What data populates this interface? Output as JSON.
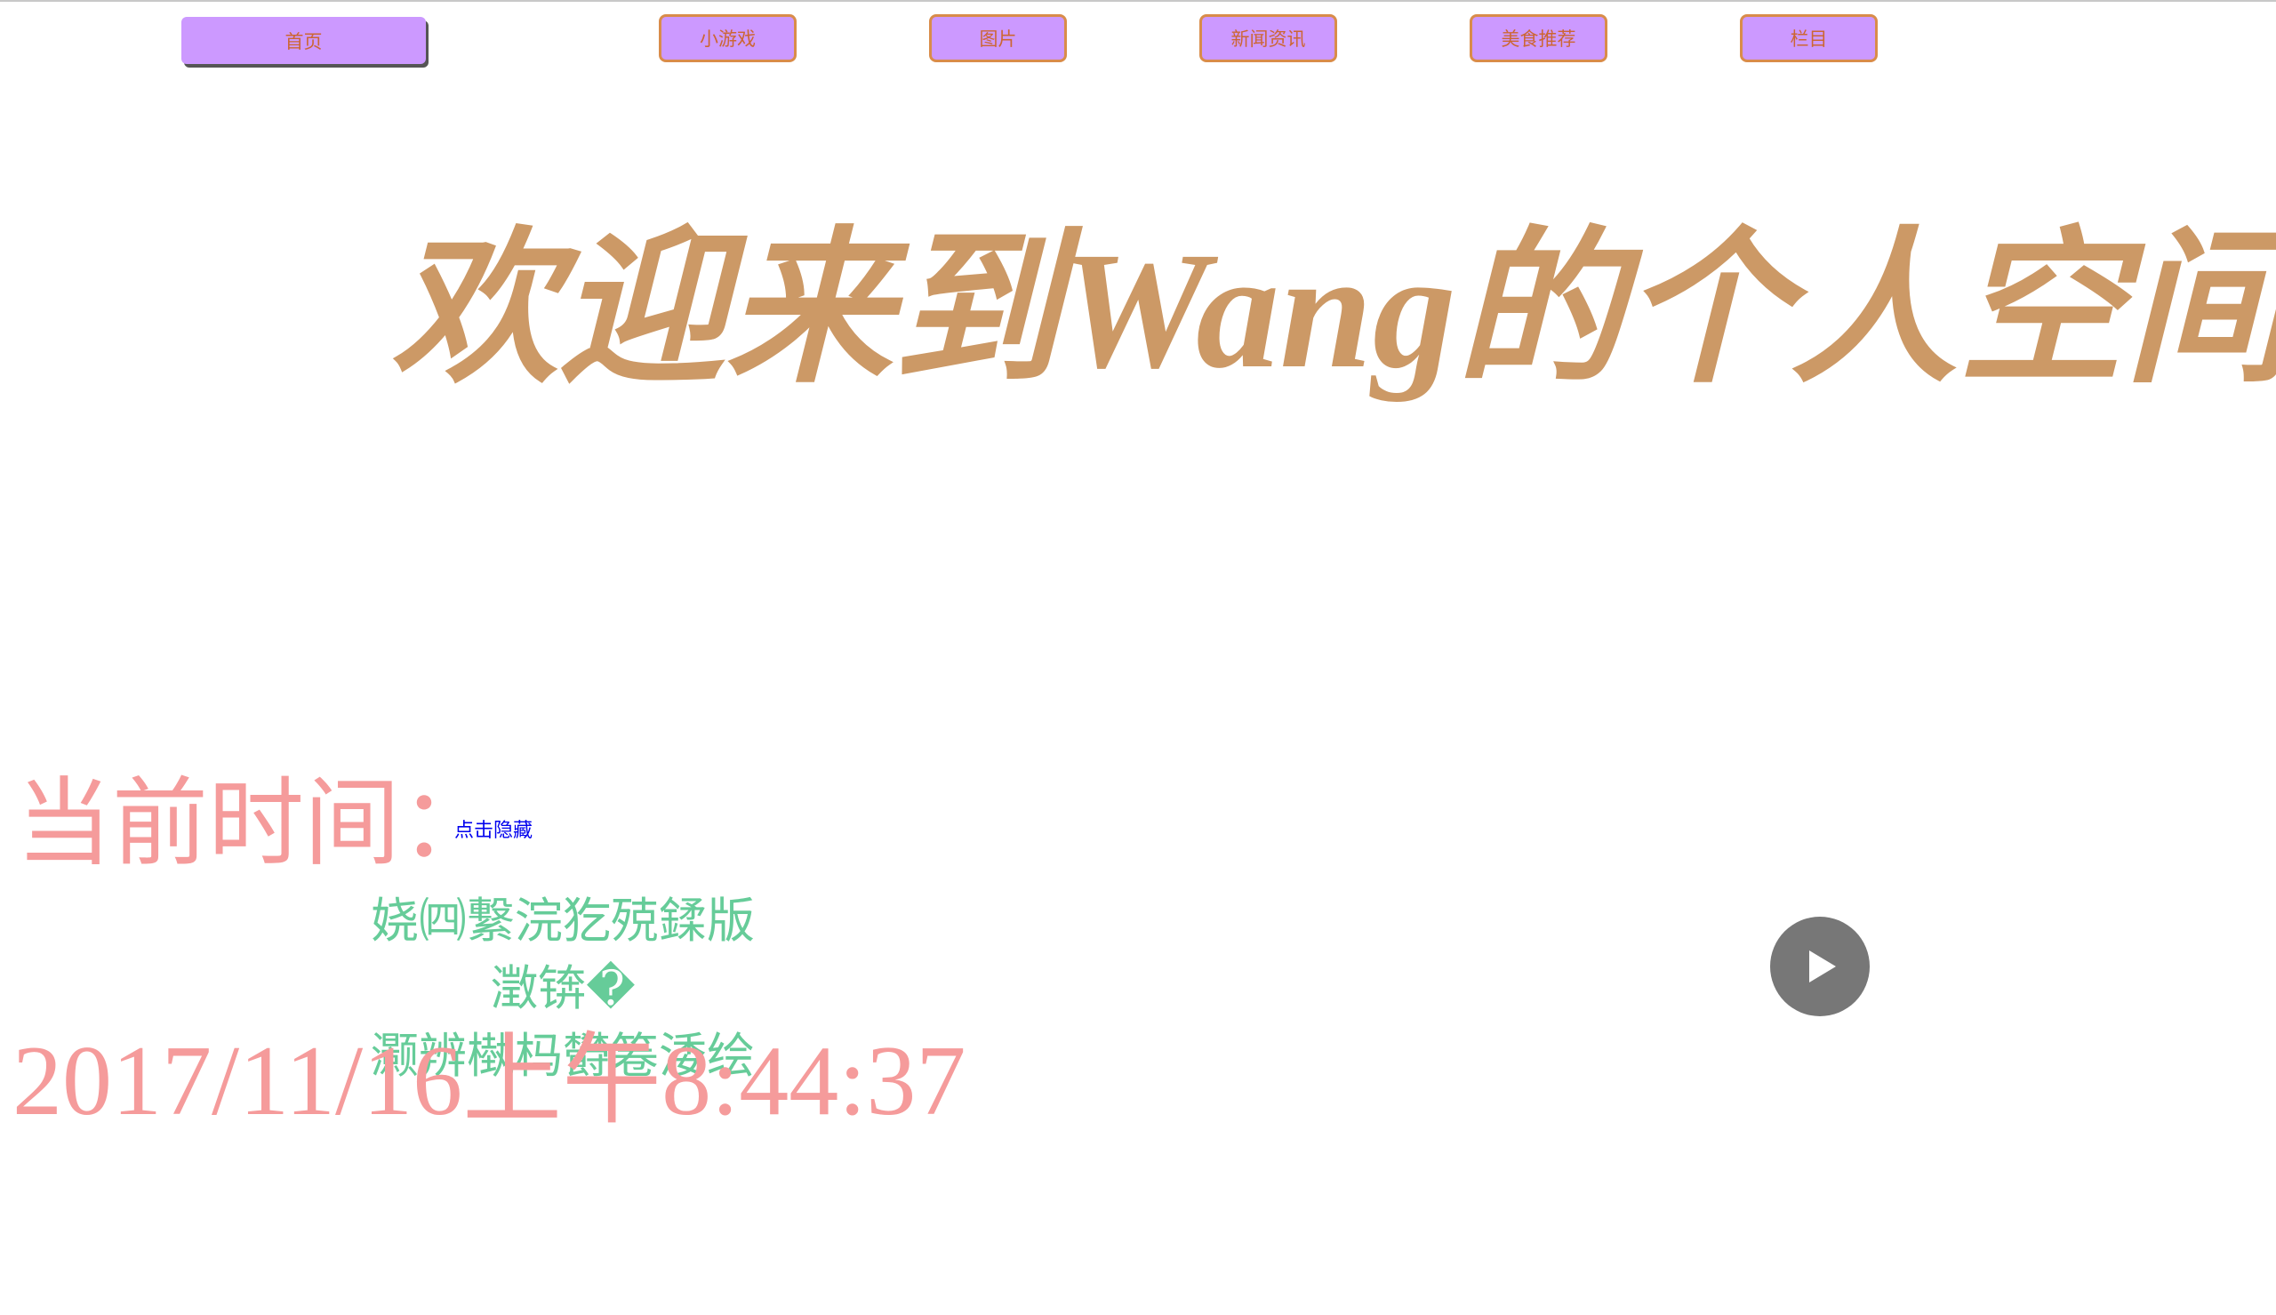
{
  "nav": {
    "items": [
      {
        "label": "首页"
      },
      {
        "label": "小游戏"
      },
      {
        "label": "图片"
      },
      {
        "label": "新闻资讯"
      },
      {
        "label": "美食推荐"
      },
      {
        "label": "栏目"
      }
    ]
  },
  "main": {
    "welcome_title": "欢迎来到Wang的个人空间",
    "time_label": "当前时间：",
    "hide_link": "点击隐藏",
    "garbled_lines": [
      "娆㈣繋浣犵殑鍒版",
      "澂锛�",
      "灏辨槸杩欎箞涹绘"
    ],
    "clock": "2017/11/16上午8:44:37"
  },
  "media": {
    "play_icon": "play-icon"
  },
  "colors": {
    "nav_bg": "#cc99ff",
    "nav_text": "#cc6633",
    "title": "#cc9966",
    "time_text": "#f59b9b",
    "garbled_text": "#66cc99",
    "link": "#0000ee"
  }
}
